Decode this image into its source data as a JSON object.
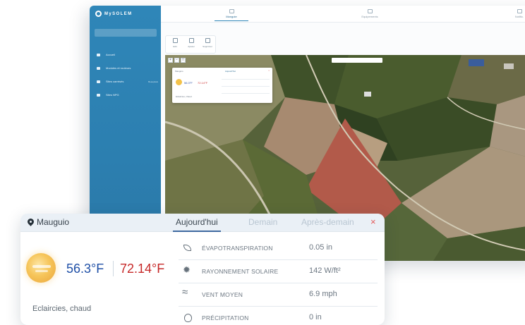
{
  "app": {
    "brand": "MySOLEM",
    "top_tabs": [
      {
        "label": "Mangute"
      },
      {
        "label": "Equipements"
      },
      {
        "label": "Notific."
      }
    ]
  },
  "sidebar": {
    "items": [
      {
        "label": "Accueil",
        "badge": ""
      },
      {
        "label": "Modules et routeurs",
        "badge": ""
      },
      {
        "label": "Sites carrésés",
        "badge": "Beaujolais"
      },
      {
        "label": "Sites NPG",
        "badge": ""
      }
    ]
  },
  "toolbox": {
    "items": [
      {
        "label": "Edit"
      },
      {
        "label": "Ajouter"
      },
      {
        "label": "Supprimer"
      }
    ]
  },
  "map_popup": {
    "location": "Mauguio",
    "tab": "Aujourd'hui",
    "close": "×",
    "low": "56.3°F",
    "high": "72.14°F",
    "desc": "Eclaircies, chaud"
  },
  "weather": {
    "location": "Mauguio",
    "tabs": [
      {
        "label": "Aujourd'hui",
        "active": true
      },
      {
        "label": "Demain",
        "active": false
      },
      {
        "label": "Après-demain",
        "active": false
      }
    ],
    "close_label": "×",
    "temp_low": "56.3°F",
    "temp_high": "72.14°F",
    "description": "Eclaircies, chaud",
    "metrics": [
      {
        "icon": "leaf-icon",
        "label": "ÉVAPOTRANSPIRATION",
        "value": "0.05 in"
      },
      {
        "icon": "radiation-icon",
        "label": "RAYONNEMENT SOLAIRE",
        "value": "142 W/ft²"
      },
      {
        "icon": "wind-icon",
        "label": "VENT MOYEN",
        "value": "6.9 mph"
      },
      {
        "icon": "drop-icon",
        "label": "PRÉCIPITATION",
        "value": "0 in"
      }
    ],
    "colors": {
      "low": "#1f4fa6",
      "high": "#c62828",
      "accent": "#2f86b8",
      "close": "#e35b5b"
    }
  }
}
